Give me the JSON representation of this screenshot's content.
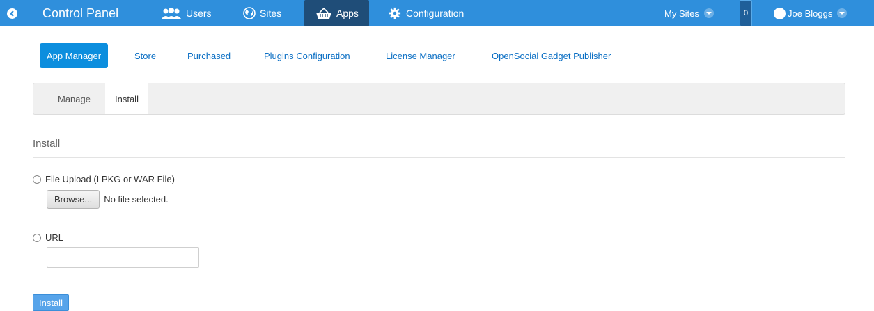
{
  "topbar": {
    "title": "Control Panel",
    "nav": {
      "users": "Users",
      "sites": "Sites",
      "apps": "Apps",
      "configuration": "Configuration"
    },
    "my_sites": "My Sites",
    "notification_count": "0",
    "user_name": "Joe Bloggs",
    "icons": [
      "back-icon",
      "users-icon",
      "globe-icon",
      "basket-icon",
      "gear-icon",
      "caret-down-icon",
      "avatar"
    ]
  },
  "subnav": {
    "app_manager": "App Manager",
    "store": "Store",
    "purchased": "Purchased",
    "plugins_configuration": "Plugins Configuration",
    "license_manager": "License Manager",
    "opensocial": "OpenSocial Gadget Publisher"
  },
  "tabs": {
    "manage": "Manage",
    "install": "Install"
  },
  "form": {
    "legend": "Install",
    "file_upload_label": "File Upload (LPKG or WAR File)",
    "browse_label": "Browse...",
    "file_status": "No file selected.",
    "url_label": "URL",
    "url_value": "",
    "install_button": "Install"
  },
  "colors": {
    "topbar": "#2f8fdc",
    "active_nav": "#1f4d78",
    "link": "#0b6fc4",
    "active_pill": "#0c8ede",
    "install_button": "#57a4ea"
  }
}
